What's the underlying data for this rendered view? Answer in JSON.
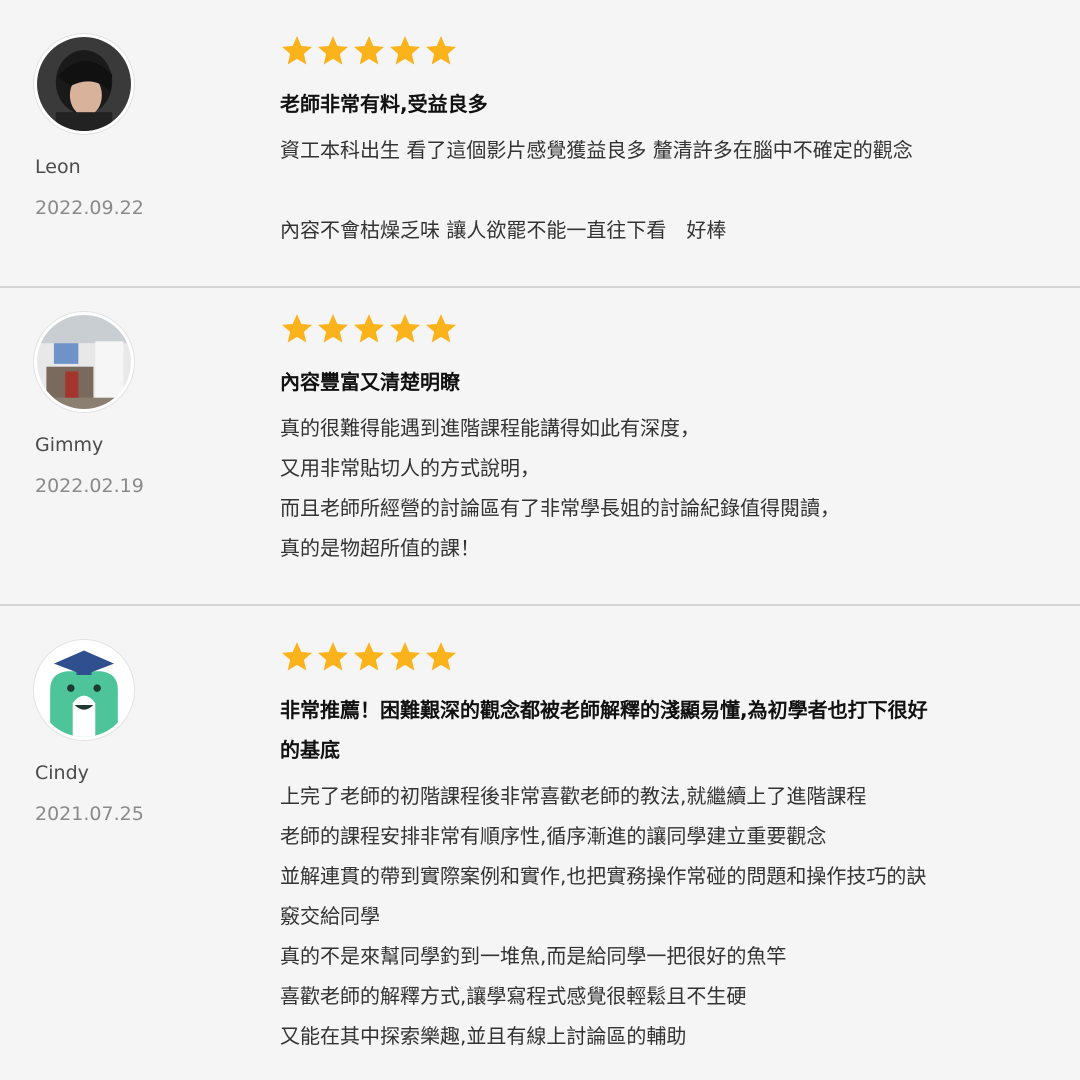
{
  "colors": {
    "background": "#f4f5f4",
    "star": "#fbb31c",
    "divider": "#d4d6d5"
  },
  "reviews": [
    {
      "user": "Leon",
      "date": "2022.09.22",
      "rating": 5,
      "avatar_icon": "user-photo-avatar",
      "title": "老師非常有料,受益良多",
      "body": [
        "資工本科出生 看了這個影片感覺獲益良多 釐清許多在腦中不確定的觀念",
        "",
        "內容不會枯燥乏味 讓人欲罷不能一直往下看　好棒"
      ]
    },
    {
      "user": "Gimmy",
      "date": "2022.02.19",
      "rating": 5,
      "avatar_icon": "room-photo-avatar",
      "title": "內容豐富又清楚明瞭",
      "body": [
        "真的很難得能遇到進階課程能講得如此有深度，",
        "又用非常貼切人的方式說明，",
        "而且老師所經營的討論區有了非常學長姐的討論紀錄值得閱讀，",
        "真的是物超所值的課！"
      ]
    },
    {
      "user": "Cindy",
      "date": "2021.07.25",
      "rating": 5,
      "avatar_icon": "graduate-mascot-avatar",
      "title_lines": [
        "非常推薦！困難艱深的觀念都被老師解釋的淺顯易懂,為初學者也打下很好",
        "的基底"
      ],
      "body": [
        "上完了老師的初階課程後非常喜歡老師的教法,就繼續上了進階課程",
        "老師的課程安排非常有順序性,循序漸進的讓同學建立重要觀念",
        "並解連貫的帶到實際案例和實作,也把實務操作常碰的問題和操作技巧的訣",
        "竅交給同學",
        "真的不是來幫同學釣到一堆魚,而是給同學一把很好的魚竿",
        "喜歡老師的解釋方式,讓學寫程式感覺很輕鬆且不生硬",
        "又能在其中探索樂趣,並且有線上討論區的輔助"
      ]
    }
  ]
}
